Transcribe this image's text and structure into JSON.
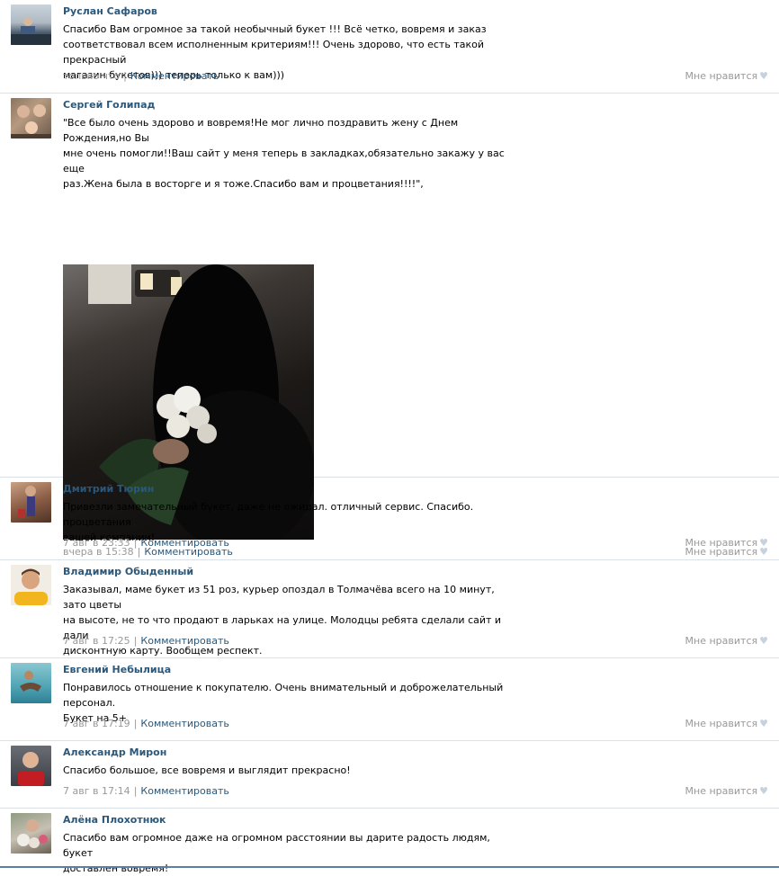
{
  "posts": [
    {
      "name": "Руслан Сафаров",
      "text": "Спасибо Вам огромное за такой необычный букет !!! Всё четко, вовремя и заказ\nсоответствовал всем исполненным критериям!!! Очень здорово, что есть такой прекрасный\nмагазин букетов))) теперь только к вам)))",
      "time": "только что",
      "comment_label": "Комментировать",
      "like_label": "Мне нравится"
    },
    {
      "name": "Сергей Голипад",
      "text": "\"Все было очень здорово и вовремя!Не мог лично поздравить жену с Днем Рождения,но Вы\nмне очень помогли!!Ваш сайт у меня теперь в закладках,обязательно закажу у вас еще\nраз.Жена была в восторге и я тоже.Спасибо вам и процветания!!!!\",",
      "time": "вчера в 15:38",
      "comment_label": "Комментировать",
      "like_label": "Мне нравится"
    },
    {
      "name": "Дмитрий Тюрин",
      "text": "Привезли замечательный букет, даже не ожидал. отличный сервис. Спасибо. процветания\nвашей компании!",
      "time": "7 авг в 23:33",
      "comment_label": "Комментировать",
      "like_label": "Мне нравится"
    },
    {
      "name": "Владимир Обыденный",
      "text": "Заказывал, маме букет из 51 роз, курьер опоздал в Толмачёва всего на 10 минут, зато цветы\nна высоте, не то что продают в ларьках на улице. Молодцы ребята сделали сайт и дали\nдисконтную карту. Вообщем респект.",
      "time": "7 авг в 17:25",
      "comment_label": "Комментировать",
      "like_label": "Мне нравится"
    },
    {
      "name": "Евгений Небылица",
      "text": "Понравилось отношение к покупателю. Очень внимательный и доброжелательный персонал.\nБукет на 5+",
      "time": "7 авг в 17:19",
      "comment_label": "Комментировать",
      "like_label": "Мне нравится"
    },
    {
      "name": "Александр Мирон",
      "text": "Спасибо большое, все вовремя и выглядит прекрасно!",
      "time": "7 авг в 17:14",
      "comment_label": "Комментировать",
      "like_label": "Мне нравится"
    },
    {
      "name": "Алёна Плохотнюк",
      "text": "Спасибо вам огромное даже на огромном расстоянии вы дарите радость людям, букет\nдоставлен вовремя!"
    }
  ],
  "separator": "|",
  "heart_glyph": "♥"
}
